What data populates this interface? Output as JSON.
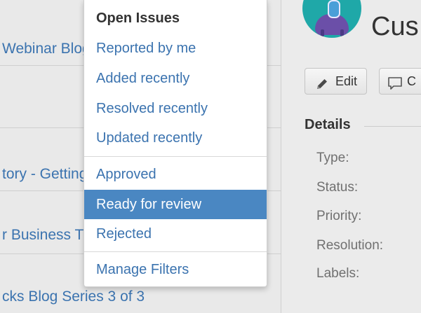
{
  "issue_list": {
    "rows": [
      {
        "title": "Webinar Blog"
      },
      {
        "title": ""
      },
      {
        "title": "tory - Getting"
      },
      {
        "title": "r Business T"
      },
      {
        "title": "cks Blog Series 3 of 3"
      }
    ]
  },
  "filter_menu": {
    "header": "Open Issues",
    "group1": [
      {
        "label": "Reported by me"
      },
      {
        "label": "Added recently"
      },
      {
        "label": "Resolved recently"
      },
      {
        "label": "Updated recently"
      }
    ],
    "group2": [
      {
        "label": "Approved"
      },
      {
        "label": "Ready for review"
      },
      {
        "label": "Rejected"
      }
    ],
    "manage_label": "Manage Filters",
    "selected": "Ready for review"
  },
  "detail": {
    "project_title": "Cus",
    "edit_label": "Edit",
    "comment_label": "C",
    "section_title": "Details",
    "fields": [
      {
        "label": "Type:"
      },
      {
        "label": "Status:"
      },
      {
        "label": "Priority:"
      },
      {
        "label": "Resolution:"
      },
      {
        "label": "Labels:"
      }
    ]
  },
  "colors": {
    "link": "#3b73af",
    "highlight": "#4a87c2",
    "background": "#ebebeb",
    "avatar": "#1fa8a8"
  },
  "icons": {
    "edit": "pencil-icon",
    "comment": "comment-icon",
    "avatar": "project-avatar-icon"
  }
}
